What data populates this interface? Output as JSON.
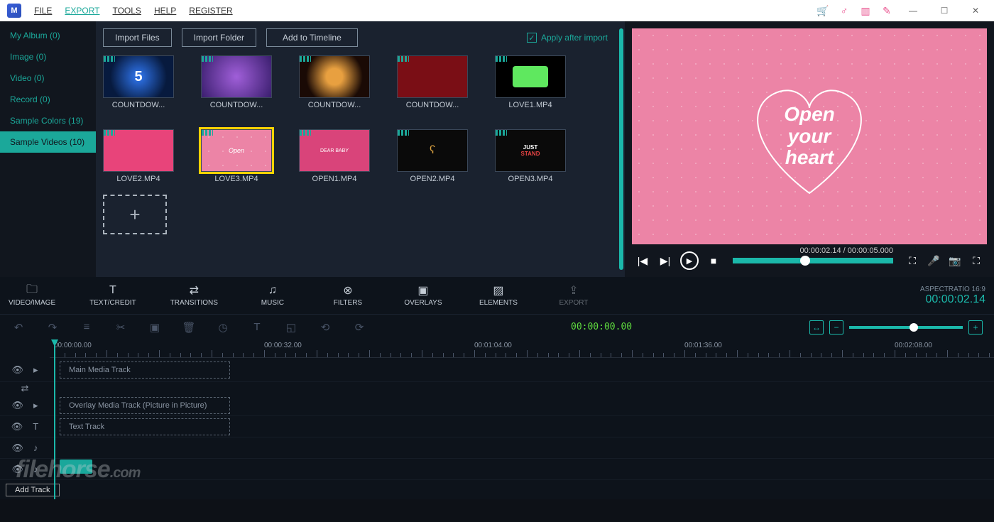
{
  "menu": {
    "file": "FILE",
    "export": "EXPORT",
    "tools": "TOOLS",
    "help": "HELP",
    "register": "REGISTER"
  },
  "sidebar": {
    "items": [
      {
        "label": "My Album (0)"
      },
      {
        "label": "Image (0)"
      },
      {
        "label": "Video (0)"
      },
      {
        "label": "Record (0)"
      },
      {
        "label": "Sample Colors (19)"
      },
      {
        "label": "Sample Videos (10)"
      }
    ],
    "active_index": 5
  },
  "import": {
    "files": "Import Files",
    "folder": "Import Folder",
    "add_timeline": "Add to Timeline",
    "apply_after": "Apply after import"
  },
  "thumbs": [
    {
      "label": "COUNTDOW..."
    },
    {
      "label": "COUNTDOW..."
    },
    {
      "label": "COUNTDOW..."
    },
    {
      "label": "COUNTDOW..."
    },
    {
      "label": "LOVE1.MP4"
    },
    {
      "label": "LOVE2.MP4"
    },
    {
      "label": "LOVE3.MP4"
    },
    {
      "label": "OPEN1.MP4"
    },
    {
      "label": "OPEN2.MP4"
    },
    {
      "label": "OPEN3.MP4"
    }
  ],
  "selected_thumb_index": 6,
  "preview": {
    "line1": "Open",
    "line2": "your",
    "line3": "heart",
    "time_current": "00:00:02.14",
    "time_total": "00:00:05.000"
  },
  "categories": {
    "video_image": "VIDEO/IMAGE",
    "text_credit": "TEXT/CREDIT",
    "transitions": "TRANSITIONS",
    "music": "MUSIC",
    "filters": "FILTERS",
    "overlays": "OVERLAYS",
    "elements": "ELEMENTS",
    "export": "EXPORT"
  },
  "aspect": {
    "label": "ASPECTRATIO 16:9",
    "time": "00:00:02.14"
  },
  "timeline": {
    "cursor_time": "00:00:00.00",
    "marks": [
      "00:00:00.00",
      "00:00:32.00",
      "00:01:04.00",
      "00:01:36.00",
      "00:02:08.00"
    ],
    "tracks": {
      "main": "Main Media Track",
      "overlay": "Overlay Media Track (Picture in Picture)",
      "text": "Text Track"
    },
    "add_track": "Add Track"
  },
  "watermark": {
    "main": "filehorse",
    "suffix": ".com"
  }
}
